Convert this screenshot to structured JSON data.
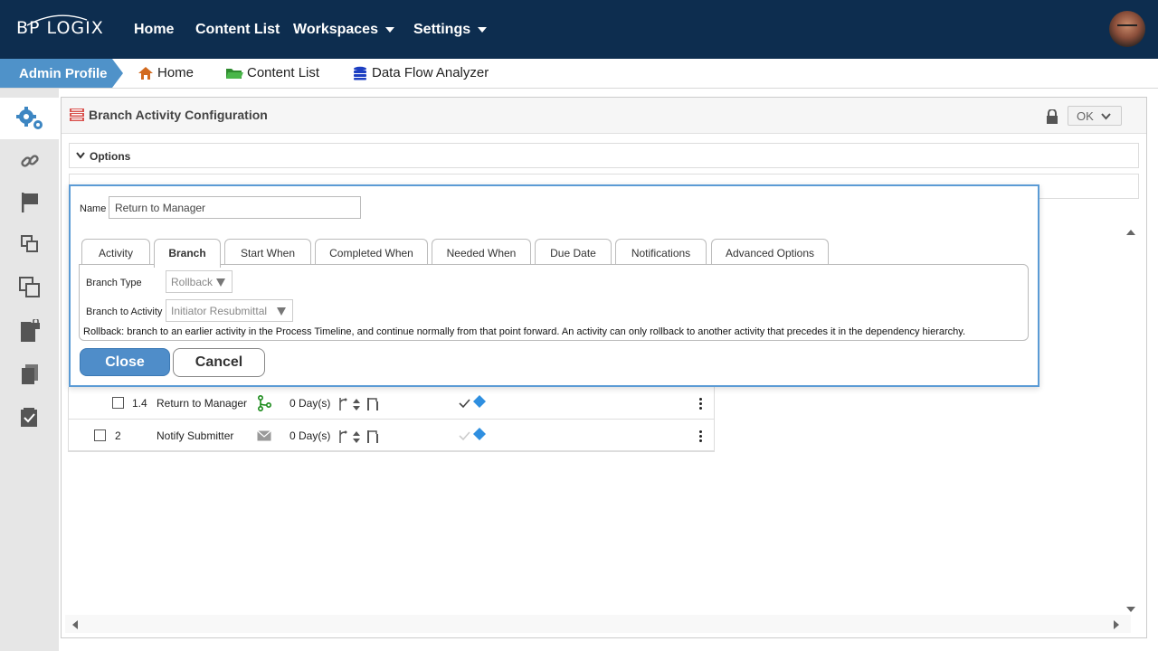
{
  "topnav": {
    "logo": "BP LOGIX",
    "items": [
      {
        "label": "Home"
      },
      {
        "label": "Content List"
      },
      {
        "label": "Workspaces"
      },
      {
        "label": "Settings"
      }
    ]
  },
  "breadcrumb": {
    "admin": "Admin Profile",
    "items": [
      {
        "label": "Home",
        "icon": "home-icon"
      },
      {
        "label": "Content List",
        "icon": "folder-icon"
      },
      {
        "label": "Data Flow Analyzer",
        "icon": "database-icon"
      }
    ]
  },
  "sidebar": {
    "items": [
      "gears-icon",
      "link-icon",
      "flag-icon",
      "copy-small-icon",
      "copy-icon",
      "locked-doc-icon",
      "documents-icon",
      "checklist-icon"
    ]
  },
  "panel": {
    "title": "Branch Activity Configuration",
    "ok_label": "OK",
    "options_label": "Options"
  },
  "rows": [
    {
      "num": "1.4",
      "name": "Return to Manager",
      "days": "0 Day(s)",
      "icon": "branch-icon"
    },
    {
      "num": "2",
      "name": "Notify Submitter",
      "days": "0 Day(s)",
      "icon": "envelope-icon"
    }
  ],
  "dialog": {
    "name_label": "Name",
    "name_value": "Return to Manager",
    "tabs": [
      "Activity",
      "Branch",
      "Start When",
      "Completed When",
      "Needed When",
      "Due Date",
      "Notifications",
      "Advanced Options"
    ],
    "active_tab": "Branch",
    "branch_type_label": "Branch Type",
    "branch_type_value": "Rollback",
    "branch_to_label": "Branch to Activity",
    "branch_to_value": "Initiator Resubmittal",
    "help_text": "Rollback: branch to an earlier activity in the Process Timeline, and continue normally from that point forward. An activity can only rollback to another activity that precedes it in the dependency hierarchy.",
    "close_label": "Close",
    "cancel_label": "Cancel"
  },
  "colors": {
    "nav_bg": "#0d2d4f",
    "accent": "#4f92c9",
    "dialog_border": "#5b9bd5"
  }
}
